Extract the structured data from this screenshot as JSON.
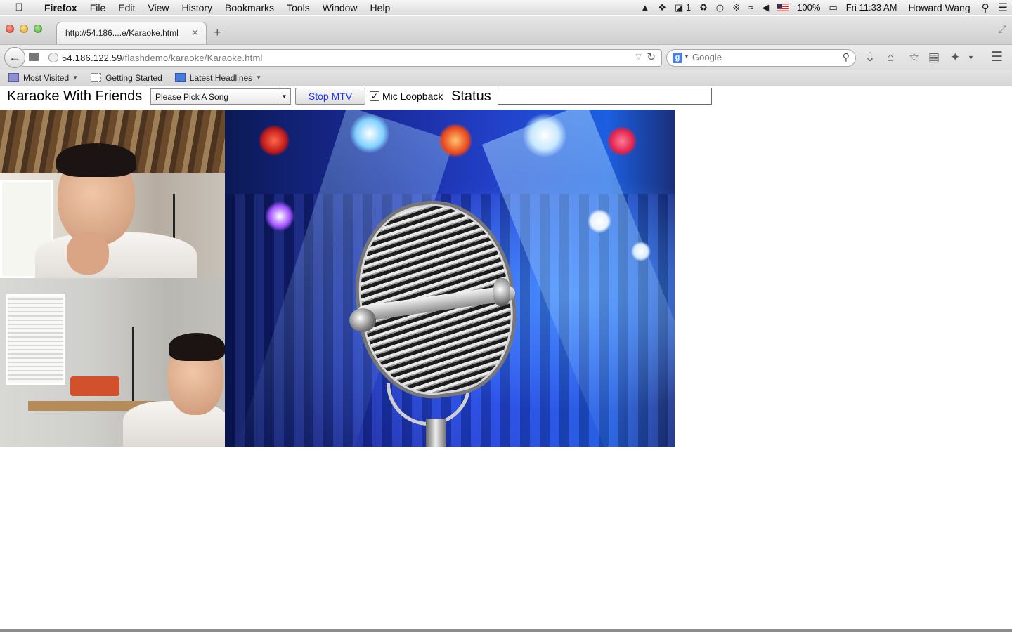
{
  "menubar": {
    "app": "Firefox",
    "items": [
      "File",
      "Edit",
      "View",
      "History",
      "Bookmarks",
      "Tools",
      "Window",
      "Help"
    ],
    "status_icons": [
      "drive-icon",
      "dropbox-icon",
      "adobe-icon",
      "sync-icon",
      "time-machine-icon",
      "bluetooth-icon",
      "wifi-icon",
      "volume-icon",
      "flag-icon"
    ],
    "adobe_count": "1",
    "battery": "100%",
    "clock": "Fri 11:33 AM",
    "user": "Howard Wang"
  },
  "browser": {
    "tab_title": "http://54.186....e/Karaoke.html",
    "url_host": "54.186.122.59",
    "url_path": "/flashdemo/karaoke/Karaoke.html",
    "search_placeholder": "Google"
  },
  "bookmarks": {
    "items": [
      {
        "label": "Most Visited",
        "icon": "folder-icon",
        "dropdown": true
      },
      {
        "label": "Getting Started",
        "icon": "page-icon",
        "dropdown": false
      },
      {
        "label": "Latest Headlines",
        "icon": "feed-icon",
        "dropdown": true
      }
    ]
  },
  "karaoke": {
    "title": "Karaoke With Friends",
    "song_select_value": "Please Pick A Song",
    "stop_button": "Stop MTV",
    "mic_loopback_label": "Mic Loopback",
    "mic_loopback_checked": true,
    "status_label": "Status",
    "status_value": ""
  }
}
